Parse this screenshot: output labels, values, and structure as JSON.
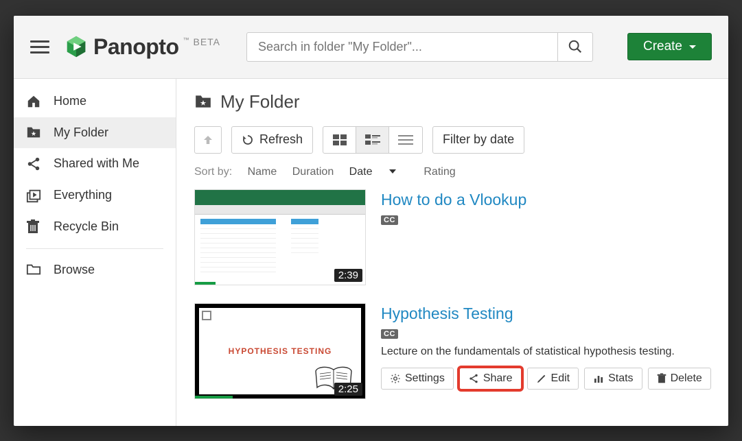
{
  "brand": {
    "name": "Panopto",
    "badge": "BETA"
  },
  "search": {
    "placeholder": "Search in folder \"My Folder\"..."
  },
  "create_label": "Create",
  "sidebar": {
    "items": [
      {
        "label": "Home"
      },
      {
        "label": "My Folder"
      },
      {
        "label": "Shared with Me"
      },
      {
        "label": "Everything"
      },
      {
        "label": "Recycle Bin"
      },
      {
        "label": "Browse"
      }
    ]
  },
  "folder": {
    "title": "My Folder"
  },
  "toolbar": {
    "refresh": "Refresh",
    "filter": "Filter by date"
  },
  "sort": {
    "label": "Sort by:",
    "options": [
      "Name",
      "Duration",
      "Date",
      "Rating"
    ],
    "active": "Date"
  },
  "videos": [
    {
      "title": "How to do a Vlookup",
      "cc": "CC",
      "duration": "2:39",
      "progress_pct": 12
    },
    {
      "title": "Hypothesis Testing",
      "cc": "CC",
      "description": "Lecture on the fundamentals of statistical hypothesis testing.",
      "duration": "2:25",
      "progress_pct": 22,
      "actions": {
        "settings": "Settings",
        "share": "Share",
        "edit": "Edit",
        "stats": "Stats",
        "delete": "Delete"
      },
      "highlight_action": "share",
      "slide_title": "HYPOTHESIS TESTING"
    }
  ]
}
